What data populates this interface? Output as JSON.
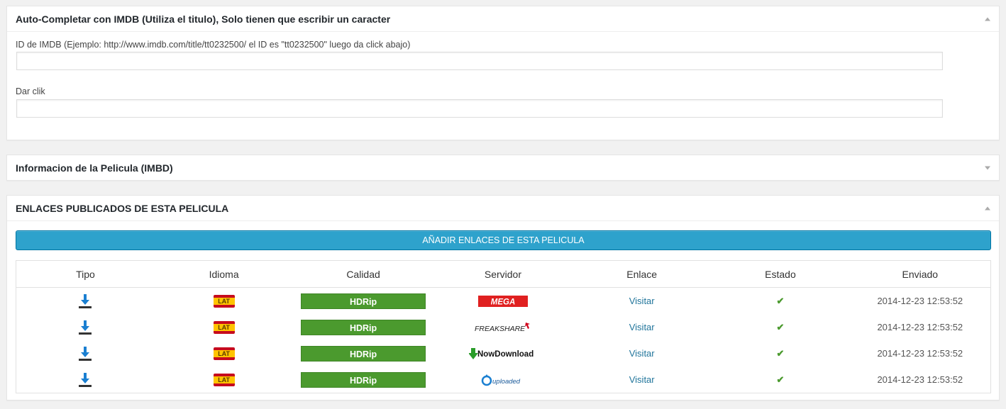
{
  "imdb_box": {
    "title": "Auto-Completar con IMDB (Utiliza el titulo), Solo tienen que escribir un caracter",
    "id_label": "ID de IMDB (Ejemplo: http://www.imdb.com/title/tt0232500/ el ID es \"tt0232500\" luego da click abajo)",
    "id_value": "",
    "click_label": "Dar clik",
    "click_value": ""
  },
  "info_box": {
    "title": "Informacion de la Pelicula (IMBD)"
  },
  "links_box": {
    "title": "ENLACES PUBLICADOS DE ESTA PELICULA",
    "add_button": "AÑADIR ENLACES DE ESTA PELICULA",
    "columns": [
      "Tipo",
      "Idioma",
      "Calidad",
      "Servidor",
      "Enlace",
      "Estado",
      "Enviado"
    ],
    "rows": [
      {
        "tipo_icon": "download-icon",
        "idioma": "LAT",
        "calidad": "HDRip",
        "servidor": "MEGA",
        "enlace": "Visitar",
        "estado_icon": "check-icon",
        "enviado": "2014-12-23 12:53:52"
      },
      {
        "tipo_icon": "download-icon",
        "idioma": "LAT",
        "calidad": "HDRip",
        "servidor": "FREAKSHARE",
        "enlace": "Visitar",
        "estado_icon": "check-icon",
        "enviado": "2014-12-23 12:53:52"
      },
      {
        "tipo_icon": "download-icon",
        "idioma": "LAT",
        "calidad": "HDRip",
        "servidor": "NowDownload",
        "enlace": "Visitar",
        "estado_icon": "check-icon",
        "enviado": "2014-12-23 12:53:52"
      },
      {
        "tipo_icon": "download-icon",
        "idioma": "LAT",
        "calidad": "HDRip",
        "servidor": "uploaded",
        "enlace": "Visitar",
        "estado_icon": "check-icon",
        "enviado": "2014-12-23 12:53:52"
      }
    ]
  },
  "colors": {
    "accent_button": "#2ea2cc",
    "quality_badge": "#4b9a2e",
    "link": "#21759b"
  }
}
